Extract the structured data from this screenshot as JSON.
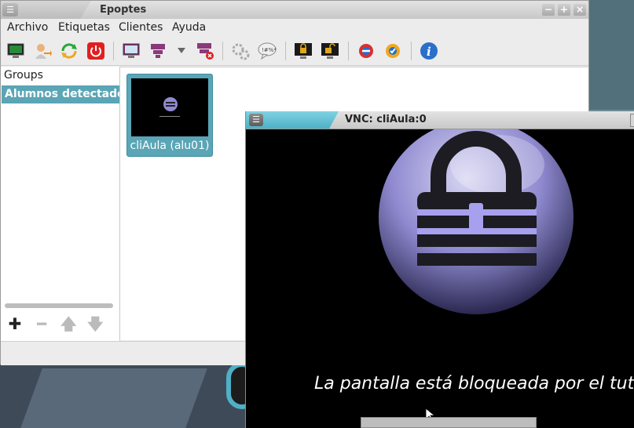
{
  "app": {
    "title": "Epoptes",
    "menu": [
      "Archivo",
      "Etiquetas",
      "Clientes",
      "Ayuda"
    ],
    "toolbar_icons": [
      "observe-screen-icon",
      "login-user-icon",
      "reboot-icon",
      "shutdown-icon",
      "broadcast-screen-icon",
      "broadcast-windowed-icon",
      "dropdown-icon",
      "stop-broadcast-icon",
      "execute-command-icon",
      "send-message-icon",
      "lock-screen-icon",
      "unlock-screen-icon",
      "mute-sound-icon",
      "unmute-sound-icon",
      "about-icon"
    ],
    "groups_header": "Groups",
    "selected_group": "Alumnos detectados",
    "client_label": "cliAula (alu01)"
  },
  "vnc": {
    "title": "VNC: cliAula:0",
    "lock_message": "La pantalla está bloqueada por el tutor."
  },
  "colors": {
    "accent": "#5aa5b6",
    "shutdown_red": "#e02020",
    "info_blue": "#2a6fc9"
  }
}
